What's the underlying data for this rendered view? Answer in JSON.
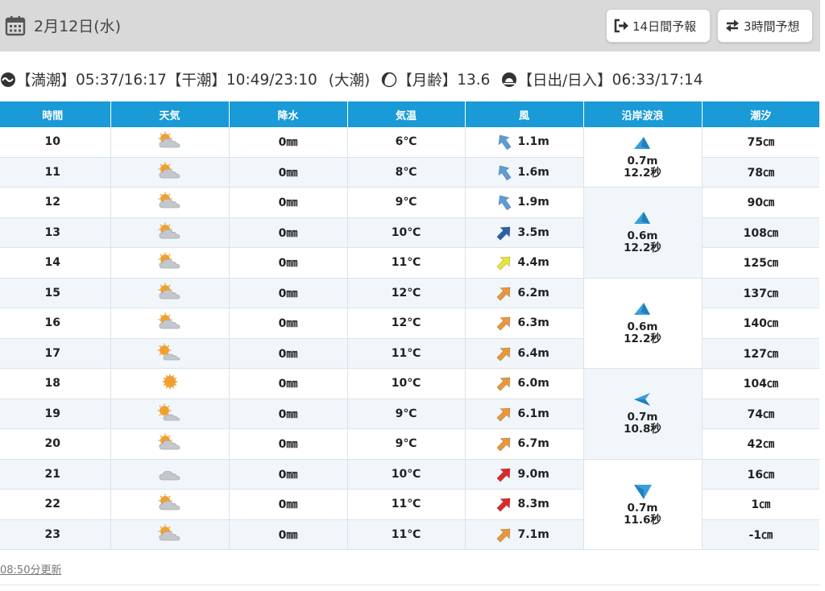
{
  "header": {
    "date": "2月12日(水)",
    "btn_14day": "14日間予報",
    "btn_3hour": "3時間予想"
  },
  "tide_info": {
    "high_label": "【満潮】",
    "high_times": "05:37/16:17",
    "low_label": "【干潮】",
    "low_times": "10:49/23:10",
    "tide_type": "(大潮)",
    "moon_label": "【月齢】",
    "moon_age": "13.6",
    "sun_label": "【日出/日入】",
    "sun_times": "06:33/17:14"
  },
  "table": {
    "headers": [
      "時間",
      "天気",
      "降水",
      "気温",
      "風",
      "沿岸波浪",
      "潮汐"
    ],
    "rows": [
      {
        "hour": "10",
        "weather": "partly-cloudy",
        "precip": "0㎜",
        "temp": "6℃",
        "wind_dir": -35,
        "wind_color": "#5d9bd5",
        "wind": "1.1m",
        "tide": "75㎝"
      },
      {
        "hour": "11",
        "weather": "partly-cloudy",
        "precip": "0㎜",
        "temp": "8℃",
        "wind_dir": -35,
        "wind_color": "#5d9bd5",
        "wind": "1.6m",
        "tide": "78㎝"
      },
      {
        "hour": "12",
        "weather": "partly-cloudy",
        "precip": "0㎜",
        "temp": "9℃",
        "wind_dir": -35,
        "wind_color": "#5d9bd5",
        "wind": "1.9m",
        "tide": "90㎝"
      },
      {
        "hour": "13",
        "weather": "partly-cloudy",
        "precip": "0㎜",
        "temp": "10℃",
        "wind_dir": 45,
        "wind_color": "#2e5fa6",
        "wind": "3.5m",
        "tide": "108㎝"
      },
      {
        "hour": "14",
        "weather": "partly-cloudy",
        "precip": "0㎜",
        "temp": "11℃",
        "wind_dir": 45,
        "wind_color": "#e8e23a",
        "wind": "4.4m",
        "tide": "125㎝"
      },
      {
        "hour": "15",
        "weather": "partly-cloudy",
        "precip": "0㎜",
        "temp": "12℃",
        "wind_dir": 45,
        "wind_color": "#e8973a",
        "wind": "6.2m",
        "tide": "137㎝"
      },
      {
        "hour": "16",
        "weather": "partly-cloudy",
        "precip": "0㎜",
        "temp": "12℃",
        "wind_dir": 45,
        "wind_color": "#e8973a",
        "wind": "6.3m",
        "tide": "140㎝"
      },
      {
        "hour": "17",
        "weather": "sunny-cloudy",
        "precip": "0㎜",
        "temp": "11℃",
        "wind_dir": 45,
        "wind_color": "#e8973a",
        "wind": "6.4m",
        "tide": "127㎝"
      },
      {
        "hour": "18",
        "weather": "sunny",
        "precip": "0㎜",
        "temp": "10℃",
        "wind_dir": 45,
        "wind_color": "#e8973a",
        "wind": "6.0m",
        "tide": "104㎝"
      },
      {
        "hour": "19",
        "weather": "sunny-cloudy",
        "precip": "0㎜",
        "temp": "9℃",
        "wind_dir": 45,
        "wind_color": "#e8973a",
        "wind": "6.1m",
        "tide": "74㎝"
      },
      {
        "hour": "20",
        "weather": "partly-cloudy",
        "precip": "0㎜",
        "temp": "9℃",
        "wind_dir": 45,
        "wind_color": "#e8973a",
        "wind": "6.7m",
        "tide": "42㎝"
      },
      {
        "hour": "21",
        "weather": "cloudy",
        "precip": "0㎜",
        "temp": "10℃",
        "wind_dir": 45,
        "wind_color": "#d92a2a",
        "wind": "9.0m",
        "tide": "16㎝"
      },
      {
        "hour": "22",
        "weather": "partly-cloudy",
        "precip": "0㎜",
        "temp": "11℃",
        "wind_dir": 45,
        "wind_color": "#d92a2a",
        "wind": "8.3m",
        "tide": "1㎝"
      },
      {
        "hour": "23",
        "weather": "partly-cloudy",
        "precip": "0㎜",
        "temp": "11℃",
        "wind_dir": 45,
        "wind_color": "#e8973a",
        "wind": "7.1m",
        "tide": "-1㎝"
      }
    ],
    "waves": [
      {
        "span": 2,
        "height": "0.7m",
        "period": "12.2秒",
        "dir": "dir-a"
      },
      {
        "span": 3,
        "height": "0.6m",
        "period": "12.2秒",
        "dir": "dir-a"
      },
      {
        "span": 3,
        "height": "0.6m",
        "period": "12.2秒",
        "dir": "dir-a"
      },
      {
        "span": 3,
        "height": "0.7m",
        "period": "10.8秒",
        "dir": "dir-b"
      },
      {
        "span": 3,
        "height": "0.7m",
        "period": "11.6秒",
        "dir": "dir-c"
      }
    ]
  },
  "footer": {
    "updated": "08:50分更新"
  }
}
